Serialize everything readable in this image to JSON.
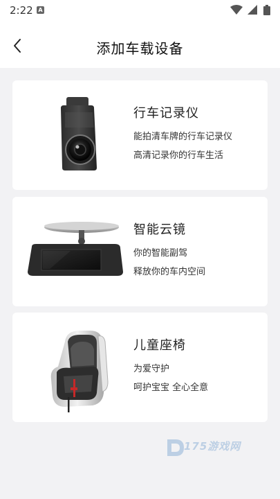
{
  "status_bar": {
    "time": "2:22",
    "notification_icon": "A"
  },
  "header": {
    "title": "添加车载设备",
    "back_icon": "chevron-left-icon"
  },
  "devices": [
    {
      "title": "行车记录仪",
      "line1": "能拍清车牌的行车记录仪",
      "line2": "高清记录你的行车生活",
      "icon": "dashcam-image"
    },
    {
      "title": "智能云镜",
      "line1": "你的智能副驾",
      "line2": "释放你的车内空间",
      "icon": "smart-mirror-image"
    },
    {
      "title": "儿童座椅",
      "line1": "为爱守护",
      "line2": "呵护宝宝 全心全意",
      "icon": "child-seat-image"
    }
  ],
  "watermark": {
    "text": "175游戏网"
  },
  "colors": {
    "background": "#f2f2f4",
    "card": "#ffffff",
    "text": "#222222"
  }
}
